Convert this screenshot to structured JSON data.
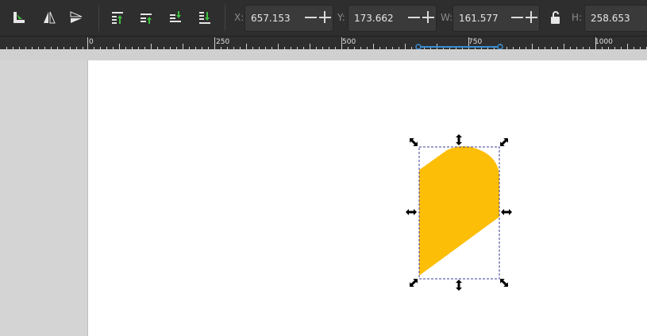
{
  "toolbar": {
    "buttons": [
      {
        "name": "transform-object-button",
        "icon": "transform-icon"
      },
      {
        "name": "flip-horizontal-button",
        "icon": "flip-horizontal-icon"
      },
      {
        "name": "flip-vertical-button",
        "icon": "flip-vertical-icon"
      },
      {
        "name": "raise-to-top-button",
        "icon": "raise-to-top-icon"
      },
      {
        "name": "raise-button",
        "icon": "raise-icon"
      },
      {
        "name": "lower-button",
        "icon": "lower-icon"
      },
      {
        "name": "lower-to-bottom-button",
        "icon": "lower-to-bottom-icon"
      }
    ],
    "x_label": "X:",
    "x_value": "657.153",
    "y_label": "Y:",
    "y_value": "173.662",
    "w_label": "W:",
    "w_value": "161.577",
    "h_label": "H:",
    "h_value": "258.653",
    "lock_icon": "unlocked-padlock-icon"
  },
  "ruler": {
    "labels": [
      "0",
      "250",
      "500",
      "750",
      "1000"
    ],
    "selection_range_color": "#3a8fd6"
  },
  "canvas": {
    "shape_fill": "#fcbe07",
    "bbox_color": "#3c3c9c",
    "handle_color": "#000000"
  }
}
